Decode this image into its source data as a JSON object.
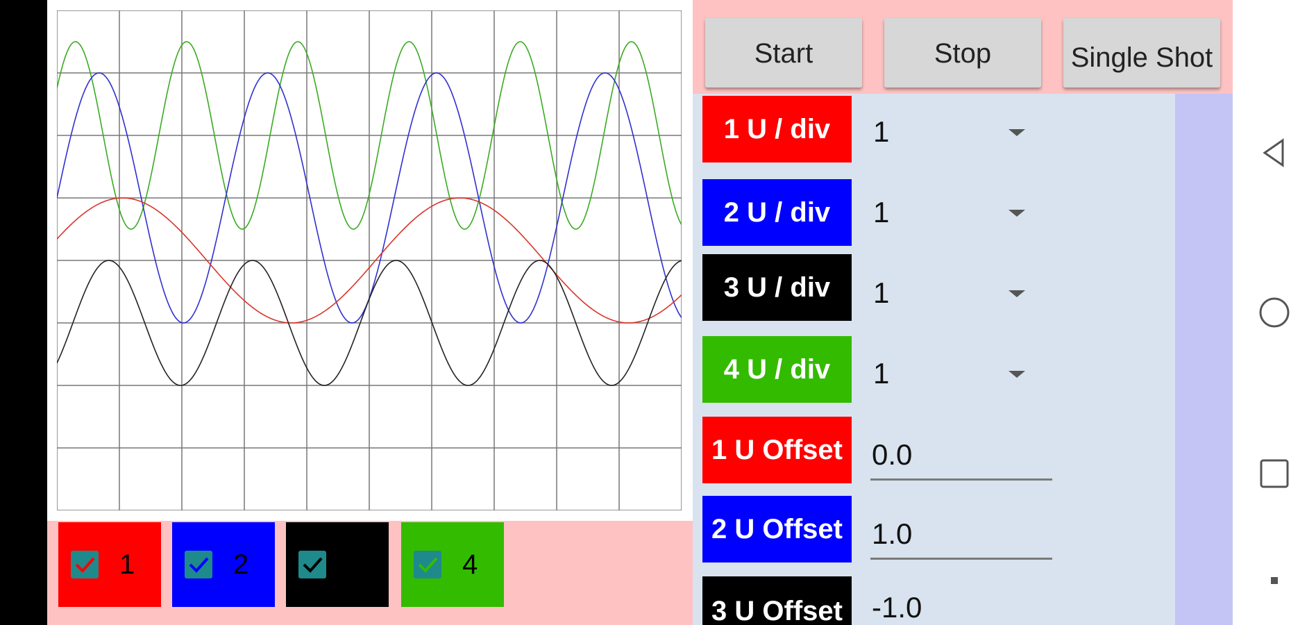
{
  "toolbar": {
    "start_label": "Start",
    "stop_label": "Stop",
    "single_shot_label": "Single Shot"
  },
  "channels": [
    {
      "checkbox_label": "1",
      "color": "#ff0000",
      "checked": true
    },
    {
      "checkbox_label": "2",
      "color": "#0000ff",
      "checked": true
    },
    {
      "checkbox_label": "",
      "color": "#000000",
      "checked": true
    },
    {
      "checkbox_label": "4",
      "color": "#33bb00",
      "checked": true
    }
  ],
  "u_div": [
    {
      "label": "1  U / div",
      "value": "1",
      "color": "#ff0000"
    },
    {
      "label": "2  U / div",
      "value": "1",
      "color": "#0000ff"
    },
    {
      "label": "3  U / div",
      "value": "1",
      "color": "#000000"
    },
    {
      "label": "4  U / div",
      "value": "1",
      "color": "#33bb00"
    }
  ],
  "offsets": [
    {
      "label": "1 U Offset",
      "value": "0.0",
      "color": "#ff0000"
    },
    {
      "label": "2 U Offset",
      "value": "1.0",
      "color": "#0000ff"
    },
    {
      "label": "3 U Offset",
      "value": "-1.0",
      "color": "#000000"
    }
  ],
  "colors": {
    "toolbar_bg": "#fec2c2",
    "controls_bg": "#d8e3ef",
    "scroll_bg": "#c4c4f5",
    "grid": "#777777",
    "trace_red": "#d9342b",
    "trace_blue": "#2f2fd0",
    "trace_black": "#222222",
    "trace_green": "#3aaa22"
  },
  "nav": {
    "back_icon": "triangle-back-icon",
    "home_icon": "circle-home-icon",
    "recents_icon": "square-recents-icon"
  }
}
